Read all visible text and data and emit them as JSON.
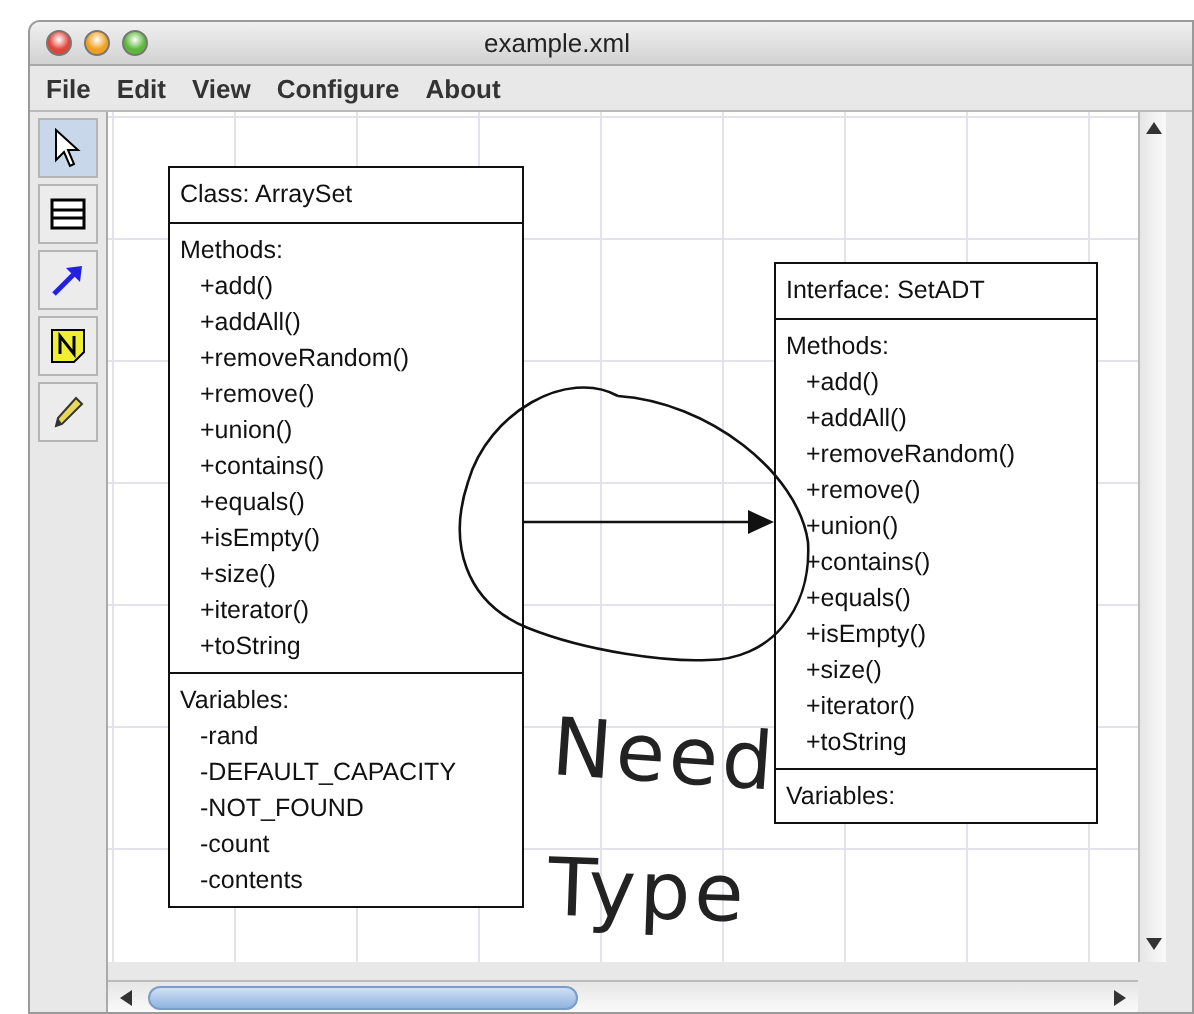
{
  "window": {
    "title": "example.xml"
  },
  "menu": [
    "File",
    "Edit",
    "View",
    "Configure",
    "About"
  ],
  "tools": [
    {
      "kind": "select",
      "selected": true
    },
    {
      "kind": "node",
      "selected": false
    },
    {
      "kind": "arrow",
      "selected": false
    },
    {
      "kind": "note",
      "selected": false
    },
    {
      "kind": "pencil",
      "selected": false
    }
  ],
  "diagram": {
    "nodes": [
      {
        "title": "Class: ArraySet",
        "sections": [
          {
            "heading": "Methods:",
            "items": [
              "+add()",
              "+addAll()",
              "+removeRandom()",
              "+remove()",
              "+union()",
              "+contains()",
              "+equals()",
              "+isEmpty()",
              "+size()",
              "+iterator()",
              "+toString"
            ]
          },
          {
            "heading": "Variables:",
            "items": [
              "-rand",
              "-DEFAULT_CAPACITY",
              "-NOT_FOUND",
              "-count",
              "-contents"
            ]
          }
        ]
      },
      {
        "title": "Interface: SetADT",
        "sections": [
          {
            "heading": "Methods:",
            "items": [
              "+add()",
              "+addAll()",
              "+removeRandom()",
              "+remove()",
              "+union()",
              "+contains()",
              "+equals()",
              "+isEmpty()",
              "+size()",
              "+iterator()",
              "+toString"
            ]
          },
          {
            "heading": "Variables:"
          }
        ]
      }
    ],
    "ink_notes": [
      "Need",
      "Type"
    ]
  }
}
